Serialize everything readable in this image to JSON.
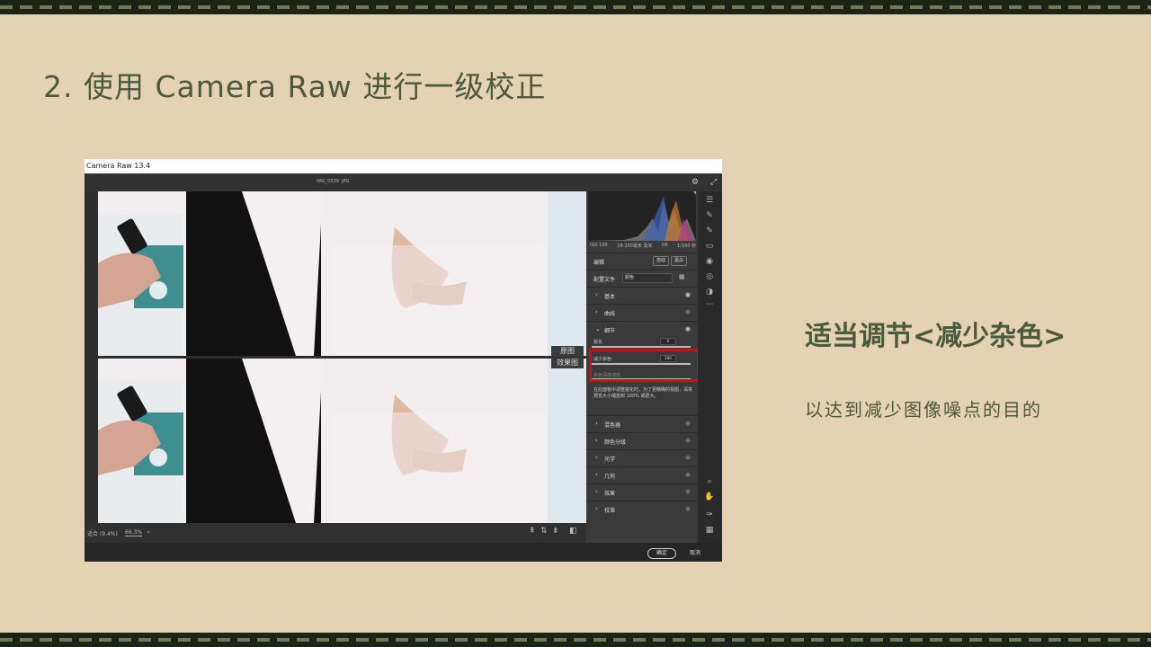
{
  "slide": {
    "title": "2. 使用 Camera Raw 进行一级校正",
    "heading": "适当调节<减少杂色>",
    "description": "以达到减少图像噪点的目的"
  },
  "colors": {
    "background": "#e5d2b3",
    "text": "#4b5a3c",
    "stripe": "#1d2416",
    "highlight": "#d20e0e"
  },
  "camera_raw": {
    "window_title": "Camera Raw 13.4",
    "filename": "IMG_0539 .JPG",
    "top_icons": [
      "gear-icon",
      "fullscreen-icon"
    ],
    "meta": {
      "iso": "ISO 100",
      "lens": "18-200毫米 毫米",
      "aperture": "f/8",
      "shutter": "1/160 秒"
    },
    "edit": {
      "label": "编辑",
      "auto": "自动",
      "bw": "黑白"
    },
    "profile": {
      "label": "配置文件",
      "value": "颜色"
    },
    "panels": {
      "basic": "基本",
      "curve": "曲线",
      "detail": "细节",
      "mixer": "混色器",
      "color_grading": "颜色分级",
      "optics": "光学",
      "geometry": "几何",
      "effects": "效果",
      "calibration": "校准"
    },
    "sliders": {
      "sharpen_label": "锐化",
      "sharpen_value": "0",
      "noise_label": "减少杂色",
      "noise_value": "100",
      "color_noise_label": "杂色深度减低",
      "color_noise_value": "0"
    },
    "note": "在此面板中调整锐化时，为了更精确的视图，请将预览大小缩放到 100% 或更大。",
    "compare": {
      "before": "原图",
      "after": "效果图"
    },
    "status": {
      "fit": "适合 (9.4%)",
      "zoom": "66.3%"
    },
    "buttons": {
      "ok": "确定",
      "cancel": "取消"
    }
  }
}
